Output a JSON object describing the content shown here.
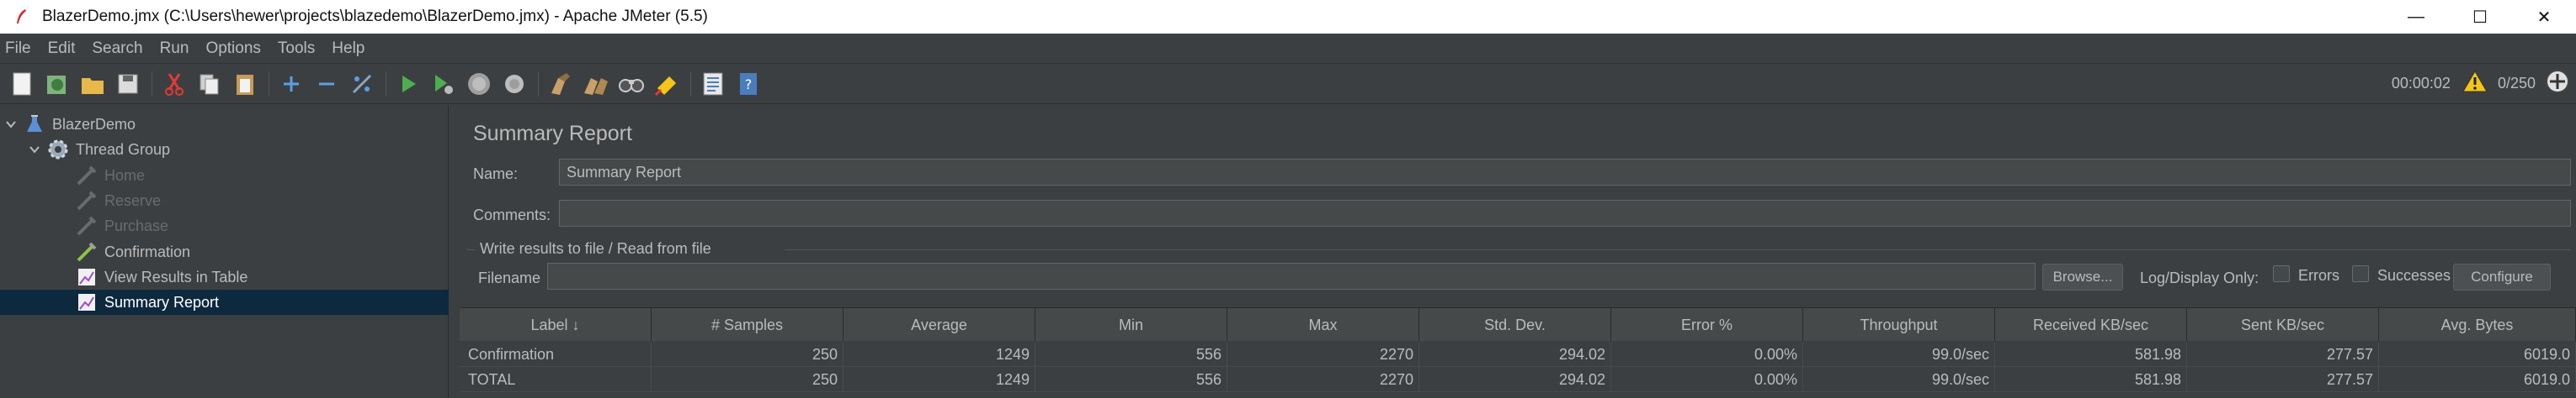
{
  "window": {
    "title": "BlazerDemo.jmx (C:\\Users\\hewer\\projects\\blazedemo\\BlazerDemo.jmx) - Apache JMeter (5.5)",
    "minimize": "—",
    "maximize": "☐",
    "close": "✕"
  },
  "menu": [
    "File",
    "Edit",
    "Search",
    "Run",
    "Options",
    "Tools",
    "Help"
  ],
  "toolbar": {
    "elapsed": "00:00:02",
    "threads": "0/250"
  },
  "tree": {
    "items": [
      {
        "label": "BlazerDemo",
        "icon": "test-plan-icon"
      },
      {
        "label": "Thread Group",
        "icon": "gear-icon"
      },
      {
        "label": "Home",
        "icon": "pipette-icon"
      },
      {
        "label": "Reserve",
        "icon": "pipette-icon"
      },
      {
        "label": "Purchase",
        "icon": "pipette-icon"
      },
      {
        "label": "Confirmation",
        "icon": "pipette-icon"
      },
      {
        "label": "View Results in Table",
        "icon": "chart-icon"
      },
      {
        "label": "Summary Report",
        "icon": "chart-icon"
      }
    ]
  },
  "panel": {
    "title": "Summary Report",
    "name_label": "Name:",
    "name_value": "Summary Report",
    "comments_label": "Comments:",
    "comments_value": "",
    "file_group_title": "Write results to file / Read from file",
    "filename_label": "Filename",
    "filename_value": "",
    "browse_label": "Browse...",
    "log_display_label": "Log/Display Only:",
    "errors_label": "Errors",
    "successes_label": "Successes",
    "configure_label": "Configure"
  },
  "table": {
    "headers": [
      "Label ↓",
      "# Samples",
      "Average",
      "Min",
      "Max",
      "Std. Dev.",
      "Error %",
      "Throughput",
      "Received KB/sec",
      "Sent KB/sec",
      "Avg. Bytes"
    ],
    "rows": [
      [
        "Confirmation",
        "250",
        "1249",
        "556",
        "2270",
        "294.02",
        "0.00%",
        "99.0/sec",
        "581.98",
        "277.57",
        "6019.0"
      ],
      [
        "TOTAL",
        "250",
        "1249",
        "556",
        "2270",
        "294.02",
        "0.00%",
        "99.0/sec",
        "581.98",
        "277.57",
        "6019.0"
      ]
    ]
  },
  "colors": {
    "background": "#3c3f41",
    "selection": "#0d293e",
    "run_green": "#4caf50",
    "warning_yellow": "#f5c518"
  }
}
